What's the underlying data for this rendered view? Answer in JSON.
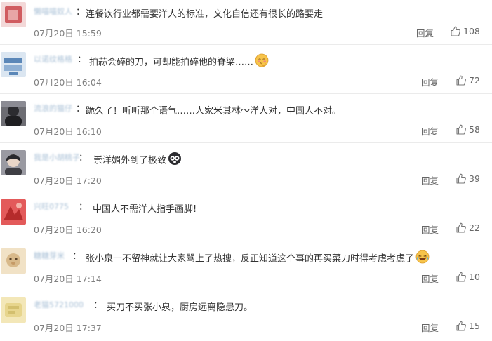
{
  "reply_label": "回复",
  "colors": {
    "username": "#a9c0d6",
    "text": "#333333",
    "meta": "#808080",
    "divider": "#ebebeb"
  },
  "comments": [
    {
      "user": "懒喵喵奴人",
      "text": "连餐饮行业都需要洋人的标准，文化自信还有很长的路要走",
      "time": "07月20日 15:59",
      "likes": "108",
      "avatar_color": "#c9474b",
      "emoji": ""
    },
    {
      "user": "以诺纹格格",
      "text": "拍蒜会碎的刀，可却能拍碎他的脊梁……",
      "time": "07月20日 16:04",
      "likes": "72",
      "avatar_color": "#5b87b8",
      "emoji": "blush-emoji"
    },
    {
      "user": "流浪的猫仔",
      "text": "跪久了！听听那个语气……人家米其林～洋人对，中国人不对。",
      "time": "07月20日 16:10",
      "likes": "58",
      "avatar_color": "#3b3b3f",
      "emoji": ""
    },
    {
      "user": "我是小胡桃子",
      "text": "崇洋媚外到了极致",
      "time": "07月20日 17:20",
      "likes": "39",
      "avatar_color": "#4a4a52",
      "emoji": "dizzy-panda-emoji"
    },
    {
      "user": "兴旺0775",
      "text": "中国人不需洋人指手画脚!",
      "time": "07月20日 16:20",
      "likes": "22",
      "avatar_color": "#d24040",
      "emoji": ""
    },
    {
      "user": "糖糖芽米",
      "text": "张小泉一不留神就让大家骂上了热搜，反正知道这个事的再买菜刀时得考虑考虑了",
      "time": "07月20日 17:14",
      "likes": "10",
      "avatar_color": "#d8b98a",
      "emoji": "laugh-cry-emoji"
    },
    {
      "user": "老猫5721000",
      "text": "买刀不买张小泉，厨房远离隐患刀。",
      "time": "07月20日 17:37",
      "likes": "15",
      "avatar_color": "#e7d58d",
      "emoji": ""
    }
  ]
}
